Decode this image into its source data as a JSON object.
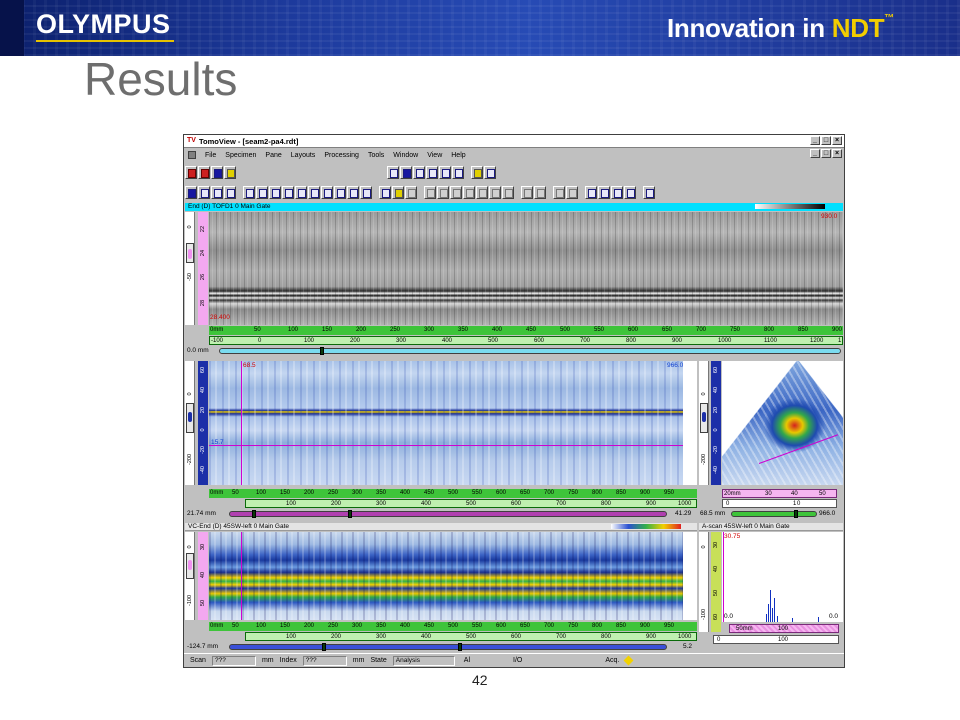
{
  "banner": {
    "logo": "OLYMPUS",
    "tagline_prefix": "Innovation in ",
    "tagline_accent": "NDT",
    "tagline_tm": "™"
  },
  "slide": {
    "title": "Results",
    "page_number": "42"
  },
  "app": {
    "window_title": "TomoView - [seam2-pa4.rdt]",
    "window_icon_text": "TV",
    "window_buttons": [
      "_",
      "□",
      "×"
    ],
    "menu": [
      "File",
      "Specimen",
      "Pane",
      "Layouts",
      "Processing",
      "Tools",
      "Window",
      "View",
      "Help"
    ],
    "panes": {
      "tofd": {
        "caption": "End (D) TOFD1 0 Main Gate",
        "value_right": "930.0",
        "value_left": "28.400",
        "depth_ticks": [
          "22",
          "24",
          "26",
          "28"
        ],
        "side_ticks": [
          "0",
          "-50"
        ],
        "ruler_top": [
          "0mm",
          "50",
          "100",
          "150",
          "200",
          "250",
          "300",
          "350",
          "400",
          "450",
          "500",
          "550",
          "600",
          "650",
          "700",
          "750",
          "800",
          "850",
          "900"
        ],
        "ruler_bottom": [
          "-100",
          "0",
          "100",
          "200",
          "300",
          "400",
          "500",
          "600",
          "700",
          "800",
          "900",
          "1000",
          "1100",
          "1200",
          "1"
        ],
        "cursor_left": "0.0 mm"
      },
      "bscan": {
        "cursor_top": "68.5",
        "value_right": "966.0",
        "marker_left": "15.7",
        "depth_ticks": [
          "60",
          "40",
          "20",
          "0",
          "-20",
          "-40"
        ],
        "side_ticks": [
          "0",
          "-200"
        ],
        "ruler_top": [
          "0mm",
          "50",
          "100",
          "150",
          "200",
          "250",
          "300",
          "350",
          "400",
          "450",
          "500",
          "550",
          "600",
          "650",
          "700",
          "750",
          "800",
          "850",
          "900",
          "950"
        ],
        "ruler_bottom": [
          "100",
          "200",
          "300",
          "400",
          "500",
          "600",
          "700",
          "800",
          "900",
          "1000"
        ],
        "cursor_left": "21.74 mm",
        "cursor_right": "41.29"
      },
      "sector": {
        "depth_ticks": [
          "60",
          "40",
          "20",
          "0",
          "-20",
          "-40"
        ],
        "side_ticks": [
          "0",
          "-200"
        ],
        "ruler_top": [
          "20mm",
          "30",
          "40",
          "50"
        ],
        "ruler_bottom": [
          "0",
          "1",
          "0"
        ],
        "cursor_left": "68.5 mm",
        "cursor_right": "966.0"
      },
      "vc": {
        "caption": "VC-End (D) 45SW-left 0 Main Gate",
        "depth_ticks": [
          "30",
          "40",
          "50"
        ],
        "side_ticks": [
          "0",
          "-100"
        ],
        "ruler_top": [
          "0mm",
          "50",
          "100",
          "150",
          "200",
          "250",
          "300",
          "350",
          "400",
          "450",
          "500",
          "550",
          "600",
          "650",
          "700",
          "750",
          "800",
          "850",
          "900",
          "950"
        ],
        "ruler_bottom": [
          "100",
          "200",
          "300",
          "400",
          "500",
          "600",
          "700",
          "800",
          "900",
          "1000"
        ],
        "cursor_left": "-124.7 mm",
        "cursor_right": "5.2"
      },
      "ascan": {
        "caption": "A-scan 45SW-left 0 Main Gate",
        "value_top": "30.75",
        "depth_ticks": [
          "30",
          "40",
          "50",
          "60"
        ],
        "side_ticks": [
          "0",
          "-100"
        ],
        "baseline_left": "0.0",
        "baseline_right": "0.0",
        "ruler_top": [
          "50mm",
          "100"
        ],
        "ruler_bottom": [
          "0",
          "100"
        ]
      }
    },
    "status": {
      "scan_label": "Scan",
      "scan_value": "???",
      "scan_unit": "mm",
      "index_label": "Index",
      "index_value": "???",
      "index_unit": "mm",
      "state_label": "State",
      "state_value": "Analysis",
      "al_label": "Al",
      "io_label": "I/O",
      "acq_label": "Acq."
    }
  }
}
